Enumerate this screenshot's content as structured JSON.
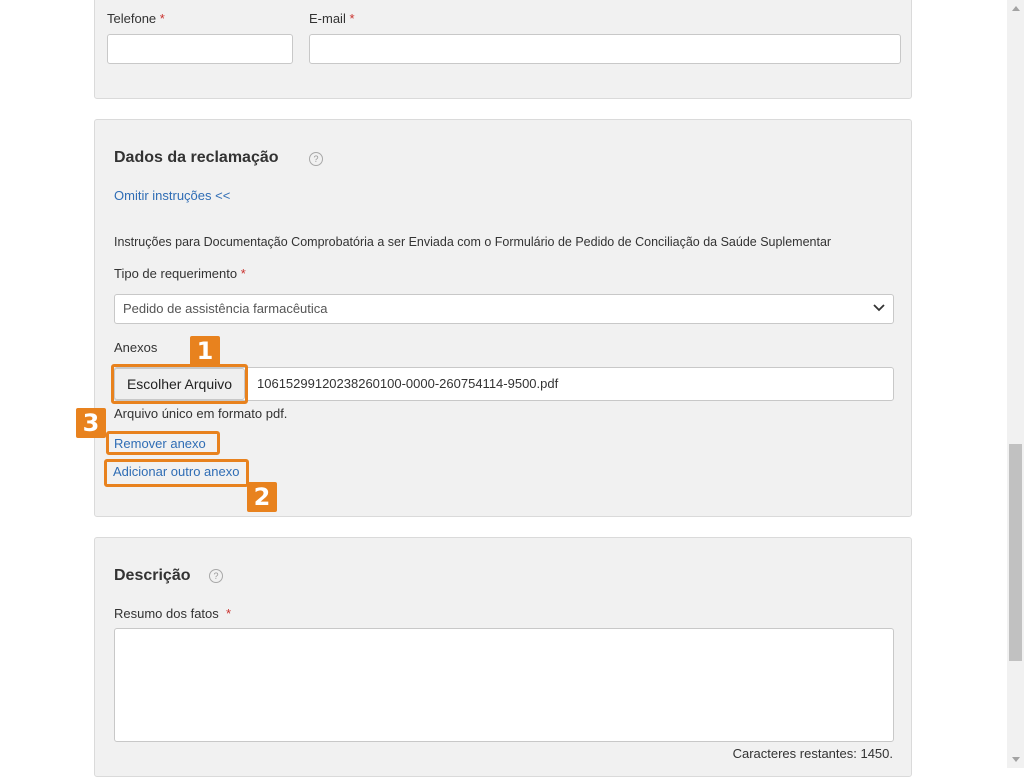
{
  "contact": {
    "phone_label": "Telefone",
    "email_label": "E-mail",
    "required_mark": "*",
    "phone_value": "",
    "email_value": ""
  },
  "claim": {
    "heading": "Dados da reclamação",
    "help_glyph": "?",
    "toggle_instructions": "Omitir instruções <<",
    "instructions_text": "Instruções para Documentação Comprobatória a ser Enviada com o Formulário de Pedido de Conciliação da Saúde Suplementar",
    "type_label": "Tipo de requerimento",
    "type_selected": "Pedido de assistência farmacêutica",
    "attachments_label": "Anexos",
    "choose_file_button": "Escolher Arquivo",
    "file_name": "10615299120238260100-0000-260754114-9500.pdf",
    "file_hint": "Arquivo único em formato pdf.",
    "remove_attachment": "Remover anexo",
    "add_attachment": "Adicionar outro anexo"
  },
  "description": {
    "heading": "Descrição",
    "help_glyph": "?",
    "summary_label": "Resumo dos fatos",
    "summary_value": "",
    "chars_remaining": "Caracteres restantes: 1450."
  },
  "annotations": {
    "badge_1": "1",
    "badge_2": "2",
    "badge_3": "3",
    "color": "#e8821e"
  },
  "icons": {
    "select_chevron": "chevron-down-icon",
    "help": "help-icon"
  }
}
